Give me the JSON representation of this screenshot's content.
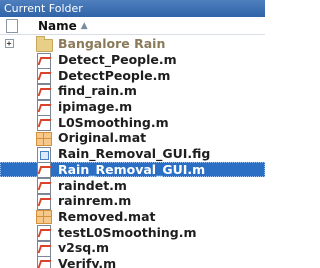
{
  "panel": {
    "title": "Current Folder"
  },
  "header": {
    "name_label": "Name",
    "sort_glyph": "▲"
  },
  "files": [
    {
      "name": "Bangalore Rain",
      "icon": "folder-icon",
      "expandable": true,
      "expander_glyph": "+"
    },
    {
      "name": "Detect_People.m",
      "icon": "m-file-icon"
    },
    {
      "name": "DetectPeople.m",
      "icon": "m-file-icon"
    },
    {
      "name": "find_rain.m",
      "icon": "m-file-icon"
    },
    {
      "name": "ipimage.m",
      "icon": "m-file-icon"
    },
    {
      "name": "L0Smoothing.m",
      "icon": "m-file-icon"
    },
    {
      "name": "Original.mat",
      "icon": "mat-file-icon"
    },
    {
      "name": "Rain_Removal_GUI.fig",
      "icon": "fig-file-icon"
    },
    {
      "name": "Rain_Removal_GUI.m",
      "icon": "m-file-icon",
      "selected": true
    },
    {
      "name": "raindet.m",
      "icon": "m-file-icon"
    },
    {
      "name": "rainrem.m",
      "icon": "m-file-icon"
    },
    {
      "name": "Removed.mat",
      "icon": "mat-file-icon"
    },
    {
      "name": "testL0Smoothing.m",
      "icon": "m-file-icon"
    },
    {
      "name": "v2sq.m",
      "icon": "m-file-icon"
    },
    {
      "name": "Verify.m",
      "icon": "m-file-icon"
    }
  ]
}
